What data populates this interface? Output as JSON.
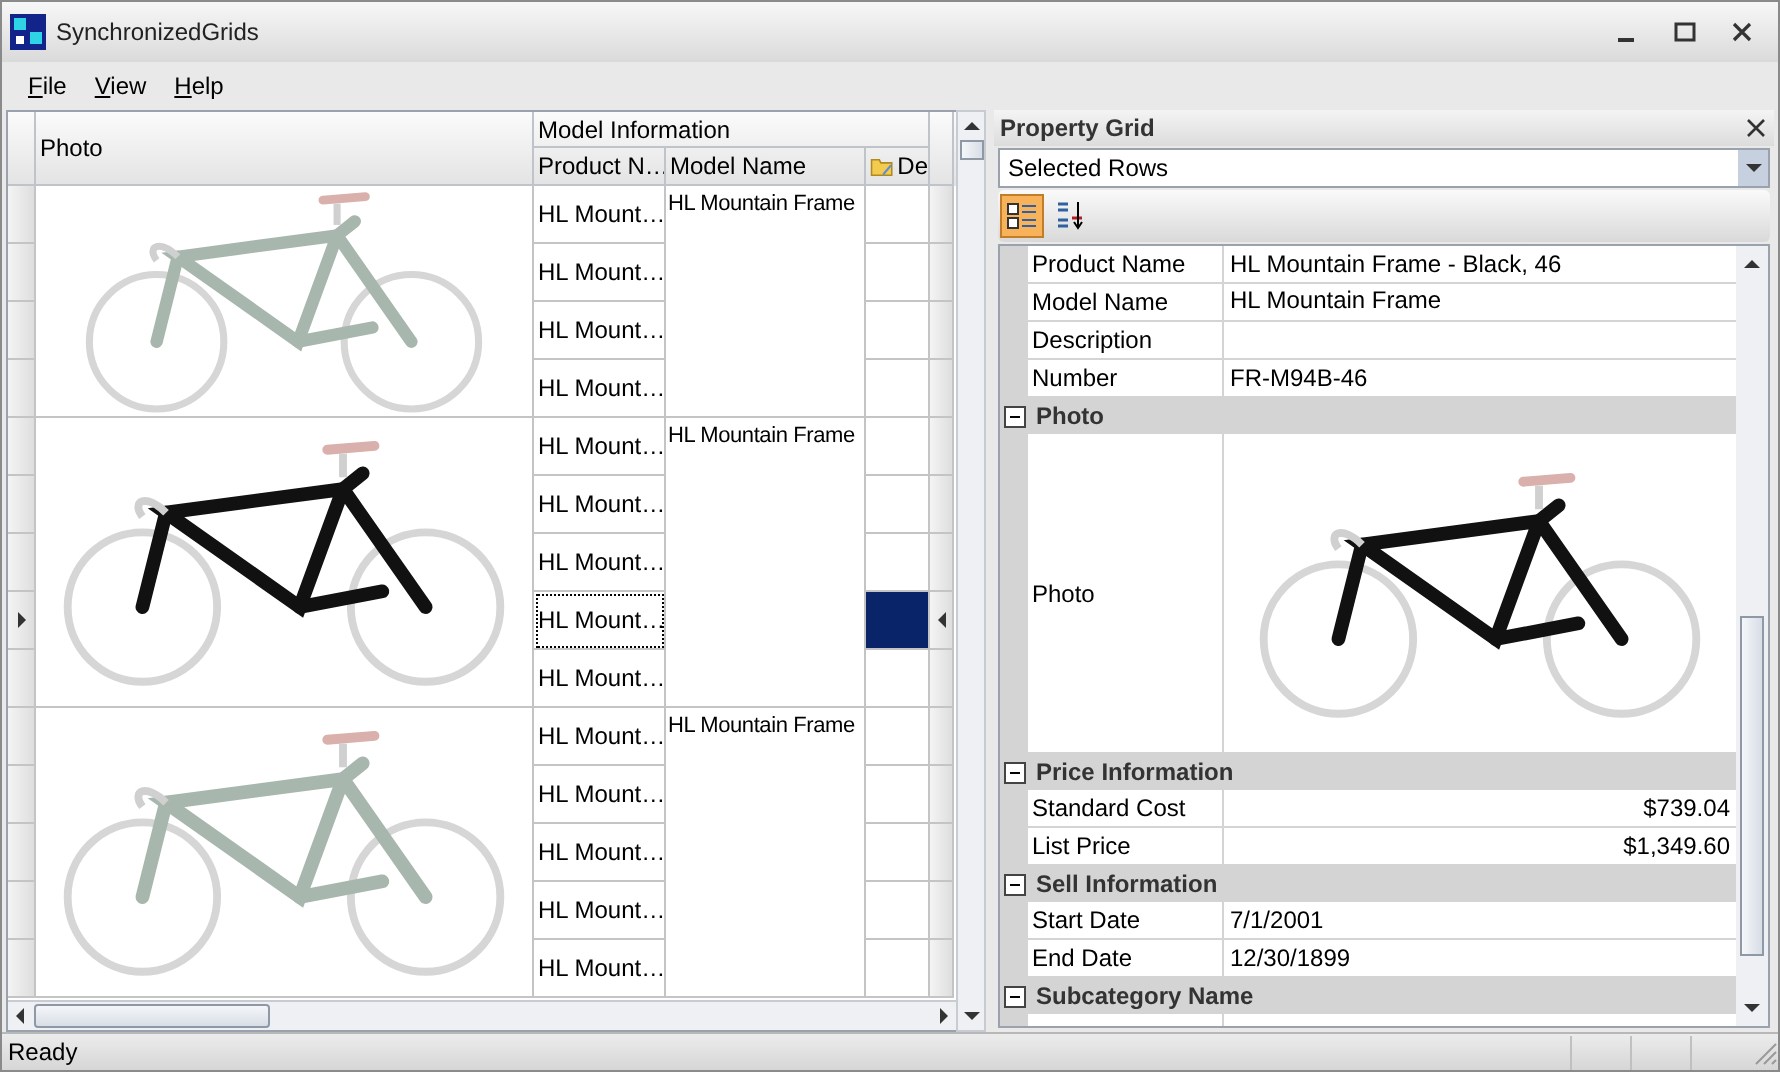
{
  "window": {
    "title": "SynchronizedGrids"
  },
  "menu": [
    {
      "label": "File"
    },
    {
      "label": "View"
    },
    {
      "label": "Help"
    }
  ],
  "grid": {
    "columns": {
      "photo": "Photo",
      "band": "Model Information",
      "product_name": "Product N…",
      "model_name": "Model Name",
      "description": "De"
    },
    "groups": [
      {
        "model_name": "HL Mountain Frame",
        "color": "#a7b7ad",
        "rows": [
          {
            "product_name": "HL Mount…",
            "selected": false
          },
          {
            "product_name": "HL Mount…",
            "selected": false
          },
          {
            "product_name": "HL Mount…",
            "selected": false
          },
          {
            "product_name": "HL Mount…",
            "selected": false
          }
        ]
      },
      {
        "model_name": "HL Mountain Frame",
        "color": "#111111",
        "rows": [
          {
            "product_name": "HL Mount…",
            "selected": false
          },
          {
            "product_name": "HL Mount…",
            "selected": false
          },
          {
            "product_name": "HL Mount…",
            "selected": false
          },
          {
            "product_name": "HL Mount…",
            "selected": true
          },
          {
            "product_name": "HL Mount…",
            "selected": false
          }
        ]
      },
      {
        "model_name": "HL Mountain Frame",
        "color": "#a7b7ad",
        "rows": [
          {
            "product_name": "HL Mount…",
            "selected": false
          },
          {
            "product_name": "HL Mount…",
            "selected": false
          },
          {
            "product_name": "HL Mount…",
            "selected": false
          },
          {
            "product_name": "HL Mount…",
            "selected": false
          },
          {
            "product_name": "HL Mount…",
            "selected": false
          }
        ]
      }
    ]
  },
  "property_grid": {
    "title": "Property Grid",
    "selector": "Selected Rows",
    "toolbar": [
      {
        "kind": "categorized",
        "selected": true
      },
      {
        "kind": "alphabetical",
        "selected": false
      }
    ],
    "properties": [
      {
        "kind": "text",
        "name": "Product Name",
        "value": "HL Mountain Frame - Black, 46"
      },
      {
        "kind": "text",
        "name": "Model Name",
        "value": "HL Mountain Frame"
      },
      {
        "kind": "text",
        "name": "Description"
      },
      {
        "kind": "text",
        "name": "Number",
        "value": "FR-M94B-46"
      },
      {
        "kind": "category",
        "name": "Photo",
        "expanded": true
      },
      {
        "kind": "photo",
        "name": "Photo",
        "color": "#111111"
      },
      {
        "kind": "category",
        "name": "Price Information",
        "expanded": true
      },
      {
        "kind": "money",
        "name": "Standard Cost",
        "value": "$739.04"
      },
      {
        "kind": "money",
        "name": "List Price",
        "value": "$1,349.60"
      },
      {
        "kind": "category",
        "name": "Sell Information",
        "expanded": true
      },
      {
        "kind": "text",
        "name": "Start Date",
        "value": "7/1/2001"
      },
      {
        "kind": "text",
        "name": "End Date",
        "value": "12/30/1899"
      },
      {
        "kind": "category",
        "name": "Subcategory Name",
        "expanded": true
      },
      {
        "kind": "partial"
      }
    ]
  },
  "status_bar": {
    "text": "Ready"
  }
}
